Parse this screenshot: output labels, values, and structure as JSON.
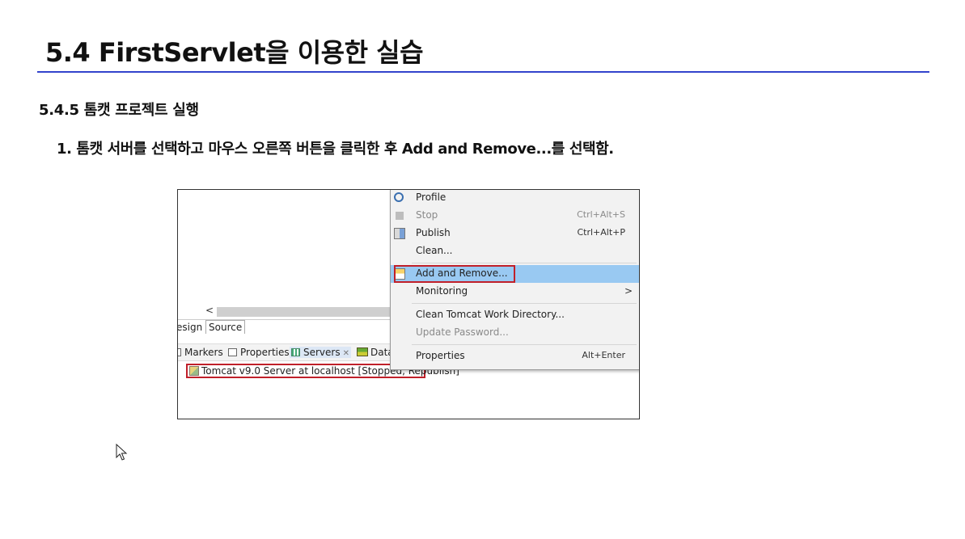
{
  "slide": {
    "title": "5.4 FirstServlet을 이용한 실습",
    "section_heading": "5.4.5  톰캣 프로젝트 실행",
    "step_text": "1. 톰캣 서버를 선택하고 마우스 오른쪽 버튼을 클릭한 후 Add and Remove...를 선택함."
  },
  "screenshot": {
    "editor_tabs": {
      "design": "esign",
      "source": "Source"
    },
    "views": [
      {
        "label": "Markers",
        "icon": "markers-icon"
      },
      {
        "label": "Properties",
        "icon": "properties-icon"
      },
      {
        "label": "Servers",
        "icon": "servers-icon",
        "active": true
      },
      {
        "label": "Data",
        "icon": "data-icon"
      }
    ],
    "server_row": "Tomcat v9.0 Server at localhost  [Stopped, Republish]",
    "context_menu": {
      "items": [
        {
          "label": "Profile",
          "accelerator": "",
          "icon": "profile-icon",
          "disabled": false
        },
        {
          "label": "Stop",
          "accelerator": "Ctrl+Alt+S",
          "icon": "stop-icon",
          "disabled": true
        },
        {
          "label": "Publish",
          "accelerator": "Ctrl+Alt+P",
          "icon": "publish-icon",
          "disabled": false
        },
        {
          "label": "Clean...",
          "accelerator": "",
          "icon": "",
          "disabled": false
        },
        {
          "label": "Add and Remove...",
          "accelerator": "",
          "icon": "add-remove-icon",
          "disabled": false,
          "highlighted": true
        },
        {
          "label": "Monitoring",
          "accelerator": "",
          "icon": "",
          "disabled": false,
          "submenu": true
        },
        {
          "label": "Clean Tomcat Work Directory...",
          "accelerator": "",
          "icon": "",
          "disabled": false
        },
        {
          "label": "Update Password...",
          "accelerator": "",
          "icon": "",
          "disabled": true
        },
        {
          "label": "Properties",
          "accelerator": "Alt+Enter",
          "icon": "",
          "disabled": false
        }
      ],
      "submenu_glyph": ">"
    }
  },
  "colors": {
    "title_rule": "#3344cc",
    "highlight_box": "#c0202a",
    "menu_selection": "#99c9f2"
  }
}
